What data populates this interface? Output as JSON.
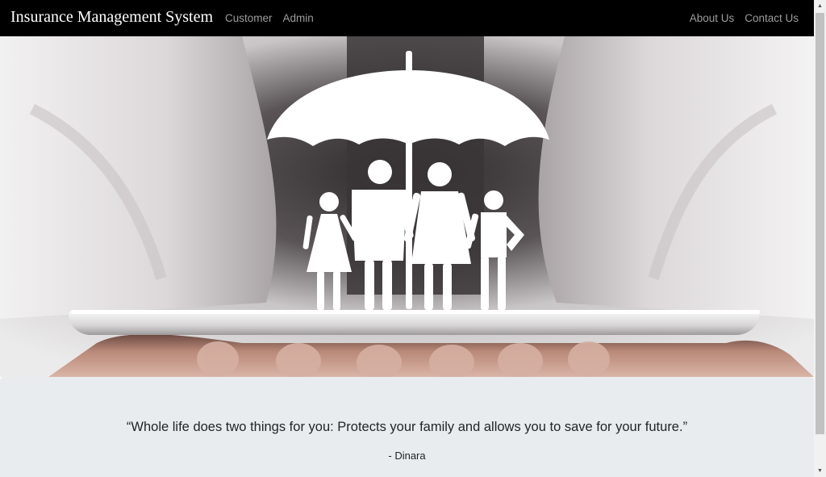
{
  "navbar": {
    "brand": "Insurance Management System",
    "left_links": [
      "Customer",
      "Admin"
    ],
    "right_links": [
      "About Us",
      "Contact Us"
    ]
  },
  "hero": {
    "image": "family-under-umbrella-on-tablet-held-by-hands"
  },
  "quote": {
    "text": "“Whole life does two things for you: Protects your family and allows you to save for your future.”",
    "author": "- Dinara"
  },
  "scrollbar": {
    "up_icon": "triangle-up-icon",
    "down_icon": "triangle-down-icon"
  },
  "colors": {
    "navbar_bg": "#000000",
    "nav_link": "#9d9d9d",
    "jumbotron_bg": "#e9ecef"
  }
}
